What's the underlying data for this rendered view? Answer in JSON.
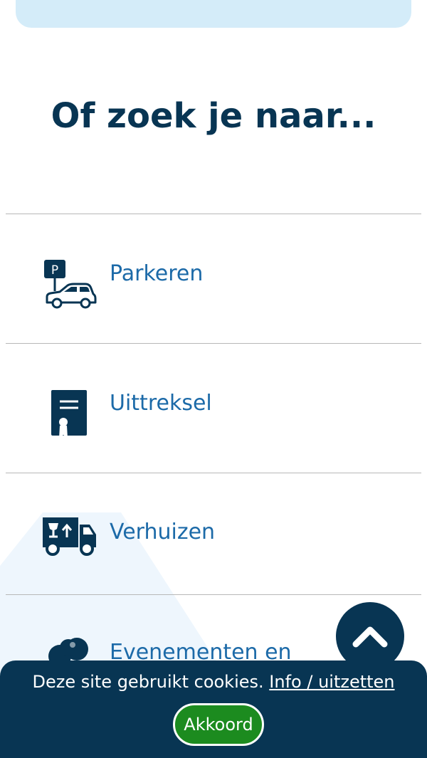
{
  "colors": {
    "primary_dark": "#083553",
    "link_blue": "#1c6aa8",
    "search_bg": "#d4ecf9",
    "accept_green": "#1c8b1f",
    "divider": "#b7b7b7"
  },
  "section": {
    "title": "Of zoek je naar..."
  },
  "links": [
    {
      "label": "Parkeren",
      "icon": "parking-car-icon"
    },
    {
      "label": "Uittreksel",
      "icon": "certificate-icon"
    },
    {
      "label": "Verhuizen",
      "icon": "moving-truck-icon"
    },
    {
      "label": "Evenementen en",
      "icon": "balloons-icon"
    }
  ],
  "scroll_top": {
    "icon": "chevron-up-icon"
  },
  "cookie_banner": {
    "text": "Deze site gebruikt cookies.",
    "link_label": "Info / uitzetten",
    "accept_label": "Akkoord"
  }
}
